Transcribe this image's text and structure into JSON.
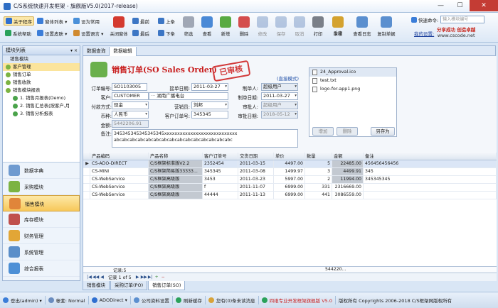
{
  "window": {
    "title": "C/S系统快速开发框架 - 旗舰版V5.0(2017-release)"
  },
  "toolbar": {
    "small": [
      {
        "label": "关于程序",
        "color": "#2f6fd0",
        "active": true
      },
      {
        "label": "窗体列表 ▾",
        "color": "#3b7dd8"
      },
      {
        "label": "设为常用",
        "color": "#4a90d9"
      },
      {
        "label": "系统帮助",
        "color": "#2aa15a"
      },
      {
        "label": "设置皮肤 ▾",
        "color": "#3b7dd8"
      },
      {
        "label": "设置语言 ▾",
        "color": "#d08a2f"
      }
    ],
    "close_all": "关闭窗体",
    "nav": [
      "最前",
      "上条",
      "最后",
      "下条"
    ],
    "actions": [
      {
        "label": "筛选",
        "color": "#a0a7b5",
        "disabled": false
      },
      {
        "label": "查看",
        "color": "#4a89d6",
        "disabled": false
      },
      {
        "label": "新增",
        "color": "#58aa43",
        "disabled": false
      },
      {
        "label": "删除",
        "color": "#d44d4d",
        "disabled": false
      },
      {
        "label": "修改",
        "color": "#6a8cbf",
        "disabled": true
      },
      {
        "label": "保存",
        "color": "#6a8cbf",
        "disabled": true
      },
      {
        "label": "取消",
        "color": "#6a8cbf",
        "disabled": true
      },
      {
        "label": "打印",
        "color": "#7a7f88",
        "disabled": false
      }
    ],
    "audit": [
      "审核",
      "反审"
    ],
    "audit_log": "查看日志",
    "copy": "复制单据",
    "shortcut_label": "快速命令:",
    "shortcut_placeholder": "输入模块编号",
    "my_settings": "我的设置:",
    "banner_1": "分享成功 创造卓越",
    "banner_2": "www.cscode.net"
  },
  "left": {
    "header": "模块列表",
    "pin": "▾ ×",
    "group": "销售模块",
    "tree": [
      {
        "label": "客户管理",
        "selected": true,
        "level": 0
      },
      {
        "label": "销售订单",
        "level": 0
      },
      {
        "label": "销售收款",
        "level": 0
      },
      {
        "label": "销售模块报表",
        "level": 0
      },
      {
        "label": "1. 销售月报表(Demo)",
        "level": 1
      },
      {
        "label": "2. 销售汇总表(按客户,月",
        "level": 1
      },
      {
        "label": "3. 销售分析报表",
        "level": 1
      }
    ],
    "modules": [
      {
        "label": "数据字典",
        "color": "#6f9bd0"
      },
      {
        "label": "采购模块",
        "color": "#7cb342"
      },
      {
        "label": "销售模块",
        "color": "#e0853a",
        "selected": true
      },
      {
        "label": "库存模块",
        "color": "#c0504d"
      },
      {
        "label": "财务管理",
        "color": "#e2a636"
      },
      {
        "label": "系统管理",
        "color": "#5a8ec9"
      },
      {
        "label": "综合报表",
        "color": "#4c8fd6"
      }
    ]
  },
  "main": {
    "tabs": [
      "数据查询",
      "数据编辑"
    ],
    "form": {
      "title": "销售订单(SO Sales Order)",
      "stamp": "已审核",
      "audit_mode": "(直接模式)",
      "order_no_label": "订单编号:",
      "order_no": "SO1103005",
      "recv_date_label": "接单日期:",
      "recv_date": "2011-03-27",
      "maker_label": "制单人:",
      "maker": "超级用户",
      "customer_label": "客户:",
      "customer_code": "CUSTOMER",
      "customer_name": "湖南广播电台",
      "make_date_label": "制单日期:",
      "make_date": "2011-03-27",
      "pay_label": "付款方式:",
      "pay": "现金",
      "sales_label": "营销员:",
      "sales": "刘邦",
      "auditor_label": "审批人:",
      "auditor": "超级用户",
      "currency_label": "币种:",
      "currency": "人民币",
      "cust_order_label": "客户订单号:",
      "cust_order": "345345",
      "audit_date_label": "审批日期:",
      "audit_date": "2018-05-12",
      "amount_label": "金额:",
      "amount": "5442206.91",
      "remark_label": "备注:",
      "remark": "345345345345345345xxxxxxxxxxxxxxxxxxxxxxxxxxxx abcabcabcabcabcabcabcabcabcabcabcabcabcabcabc"
    },
    "attachments": [
      "24_Approval.ico",
      "test.txt",
      "logo-for-app1.png"
    ],
    "att_buttons": [
      "增加",
      "删除",
      "另存为"
    ],
    "grid": {
      "headers": [
        "产品编码",
        "产品名称",
        "客户订单号",
        "交货日期",
        "单价",
        "数量",
        "金额",
        "备注"
      ],
      "rows": [
        [
          "CS-ADO-DIRECT",
          "C/S框架标准版V2.2",
          "2352454",
          "2011-03-15",
          "4497.00",
          "5",
          "22485.00",
          "456456456456"
        ],
        [
          "CS-MINI",
          "C/S框架简易版33333...",
          "345345",
          "2011-03-08",
          "1499.97",
          "3",
          "4499.91",
          "345"
        ],
        [
          "CS-WebService",
          "C/S框架高级版",
          "3453",
          "2011-03-23",
          "5997.00",
          "2",
          "11994.00",
          "345345345"
        ],
        [
          "CS-WebService",
          "C/S框架高级版",
          "f",
          "2011-11-07",
          "6999.00",
          "331",
          "2316669.00",
          ""
        ],
        [
          "CS-WebService",
          "C/S框架高级版",
          "44444",
          "2011-11-13",
          "6999.00",
          "441",
          "3086559.00",
          ""
        ]
      ],
      "footer_count": "记录:5",
      "footer_sum": "544220..."
    },
    "nav": {
      "label": "记录 1 of 5"
    }
  },
  "bottom_tabs": [
    "销售模块",
    "采购订单(PO)",
    "销售订单(SO)"
  ],
  "status": {
    "user": "登出(admin) ▾",
    "account": "帐套: Normal",
    "conn": "ADODirect ▾",
    "company": "公司资料设置",
    "refresh": "刷新缓存",
    "messages": "您有(0)条未读消息",
    "product": "四维专业开发框架旗舰版 V5.0",
    "copyright": "版权所有 Copyrights 2006-2018 C/S框架网版权所有"
  }
}
